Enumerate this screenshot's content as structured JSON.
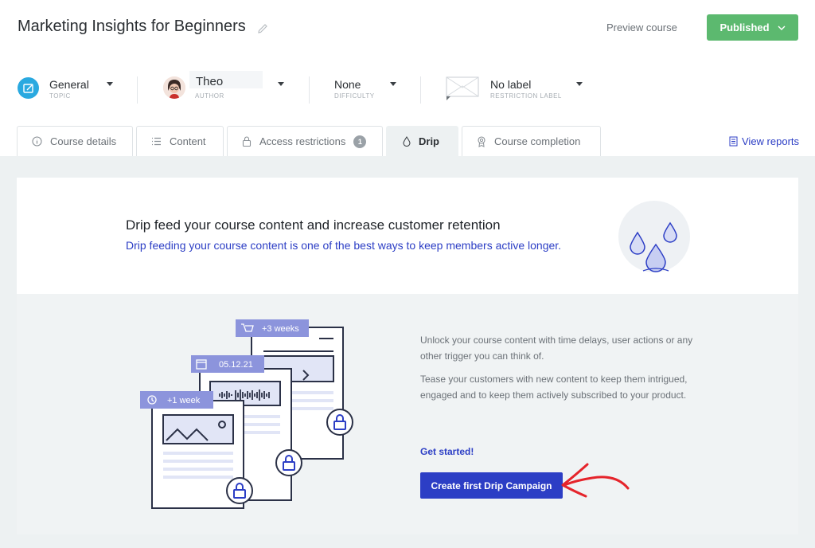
{
  "header": {
    "course_title": "Marketing Insights for Beginners",
    "preview_label": "Preview course",
    "published_label": "Published"
  },
  "meta": {
    "topic": {
      "value": "General",
      "label": "TOPIC"
    },
    "author": {
      "value": "Theo",
      "label": "AUTHOR"
    },
    "difficulty": {
      "value": "None",
      "label": "DIFFICULTY"
    },
    "restriction": {
      "value": "No label",
      "label": "RESTRICTION LABEL"
    }
  },
  "tabs": [
    {
      "label": "Course details",
      "icon": "info-icon"
    },
    {
      "label": "Content",
      "icon": "list-icon"
    },
    {
      "label": "Access restrictions",
      "icon": "lock-icon",
      "badge": "1"
    },
    {
      "label": "Drip",
      "icon": "drop-icon",
      "active": true
    },
    {
      "label": "Course completion",
      "icon": "award-icon"
    }
  ],
  "view_reports": "View reports",
  "drip": {
    "title": "Drip feed your course content and increase customer retention",
    "subtitle": "Drip feeding your course content is one of the best ways to keep members active longer.",
    "tag_weeks3": "+3 weeks",
    "tag_date": "05.12.21",
    "tag_week1": "+1 week",
    "desc1": "Unlock your course content with time delays, user actions or any other trigger you can think of.",
    "desc2": "Tease your customers with new content to keep them intrigued, engaged and to keep them actively subscribed to your product.",
    "get_started": "Get started!",
    "cta": "Create first Drip Campaign"
  },
  "colors": {
    "accent": "#2c3ec5",
    "published": "#5cb96f",
    "annotation_arrow": "#e5242b"
  }
}
